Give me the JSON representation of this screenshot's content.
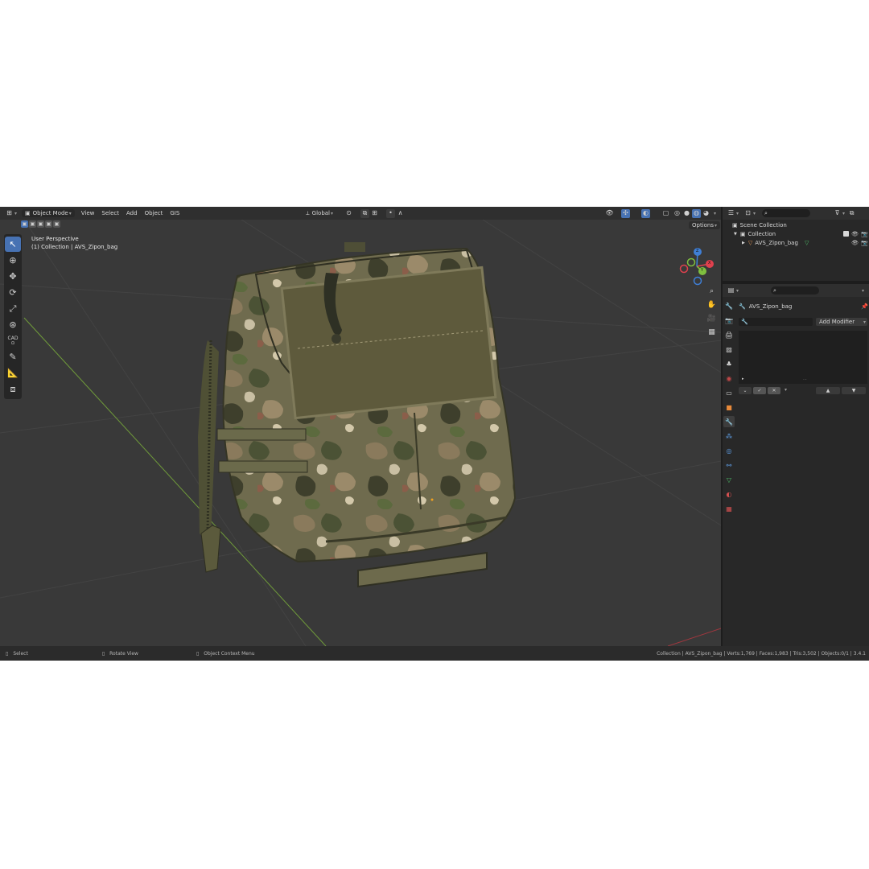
{
  "header": {
    "editor_type_icon": "editor-type-icon",
    "mode": "Object Mode",
    "menu": [
      "View",
      "Select",
      "Add",
      "Object",
      "GIS"
    ],
    "transform_orientation": "Global"
  },
  "viewport": {
    "perspective": "User Perspective",
    "collection_info": "(1) Collection | AVS_Zipon_bag",
    "options_label": "Options",
    "gizmo_axes": {
      "x": "X",
      "y": "Y",
      "z": "Z"
    },
    "cad_label": "CAD"
  },
  "tools": [
    "select-box-icon",
    "cursor-icon",
    "move-icon",
    "rotate-icon",
    "scale-icon",
    "transform-icon",
    "cad-icon",
    "annotate-icon",
    "measure-icon",
    "add-cube-icon"
  ],
  "outliner": {
    "scene_collection": "Scene Collection",
    "collection": "Collection",
    "object": "AVS_Zipon_bag"
  },
  "properties": {
    "object_name": "AVS_Zipon_bag",
    "add_modifier": "Add Modifier"
  },
  "status_bar": {
    "select": "Select",
    "rotate_view": "Rotate View",
    "context_menu": "Object Context Menu",
    "stats": "Collection | AVS_Zipon_bag | Verts:1,769 | Faces:1,983 | Tris:3,502 | Objects:0/1 | 3.4.1"
  },
  "colors": {
    "accent": "#4772b3",
    "axis_x": "#e0414e",
    "axis_y": "#7fbf3f",
    "axis_z": "#3f7fd6",
    "bag_camo_base": "#6c6a4c",
    "velcro_panel": "#5e5a3c"
  }
}
